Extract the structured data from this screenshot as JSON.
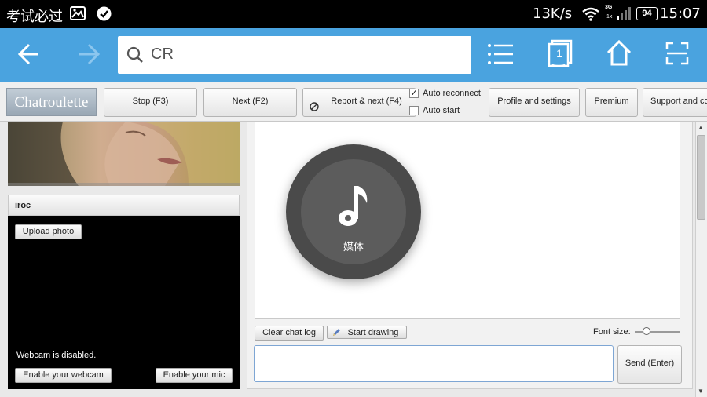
{
  "status_bar": {
    "app_label": "考试必过",
    "net_speed": "13K/s",
    "network_type_top": "3G",
    "network_type_bottom": "1x",
    "battery": "94",
    "time": "15:07"
  },
  "browser": {
    "url_text": "CR",
    "tab_count": "1"
  },
  "site": {
    "logo": "Chatroulette",
    "buttons": {
      "stop": "Stop (F3)",
      "next": "Next (F2)",
      "report_next": "Report & next (F4)",
      "profile": "Profile and settings",
      "premium": "Premium",
      "support": "Support and co"
    },
    "checkboxes": {
      "auto_reconnect": {
        "label": "Auto reconnect",
        "checked": true
      },
      "auto_start": {
        "label": "Auto start",
        "checked": false
      }
    }
  },
  "left_panel": {
    "username": "iroc",
    "upload_photo": "Upload photo",
    "webcam_status": "Webcam is disabled.",
    "enable_webcam": "Enable your webcam",
    "enable_mic": "Enable your mic"
  },
  "chat": {
    "clear_log": "Clear chat log",
    "start_drawing": "Start drawing",
    "font_size_label": "Font size:",
    "send": "Send (Enter)",
    "font_size_slider_fraction": 0.25
  },
  "media_overlay": {
    "label": "媒体"
  },
  "colors": {
    "browser_bar": "#4aa3df",
    "status_bar": "#000000",
    "media_circle": "#4a4a4a"
  }
}
